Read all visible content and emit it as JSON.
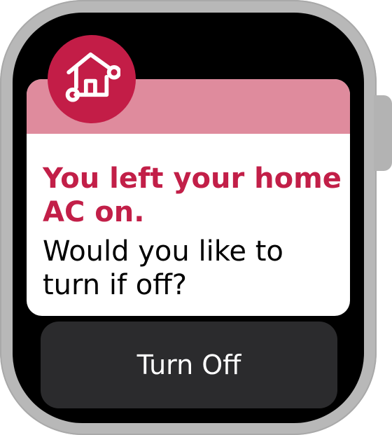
{
  "notification": {
    "title": "You left your home AC on.",
    "message": "Would you like to turn if off?",
    "icon": "smart-home-icon",
    "accent_color": "#c31d47",
    "header_color": "#df8b9d"
  },
  "actions": {
    "turn_off_label": "Turn Off"
  }
}
